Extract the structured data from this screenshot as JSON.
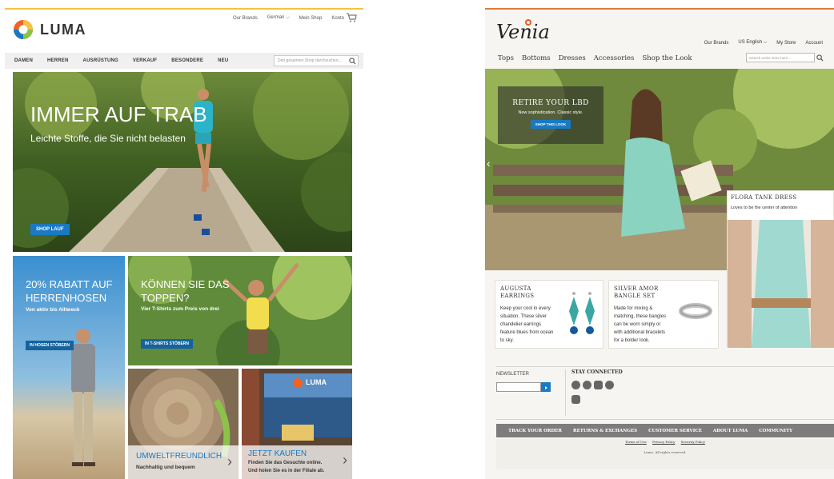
{
  "luma": {
    "brand": "LUMA",
    "toplinks": [
      "Our Brands",
      "German",
      "Mein Shop",
      "Konto"
    ],
    "nav": [
      "DAMEN",
      "HERREN",
      "AUSRÜSTUNG",
      "VERKAUF",
      "BESONDERE",
      "NEU"
    ],
    "search_placeholder": "Den gesamten Shop durchsuchen...",
    "hero": {
      "title": "IMMER AUF TRAB",
      "subtitle": "Leichte Stoffe, die Sie nicht belasten",
      "button": "SHOP LAUF"
    },
    "tile_pants": {
      "title_line1": "20% RABATT AUF",
      "title_line2": "HERRENHOSEN",
      "subtitle": "Von aktiv bis Alltweck",
      "button": "IN HOSEN STÖBERN"
    },
    "tile_top": {
      "title_line1": "KÖNNEN SIE DAS",
      "title_line2": "TOPPEN?",
      "subtitle": "Vier T-Shirts zum Preis von drei",
      "button": "IN T-SHIRTS STÖBERN"
    },
    "tile_eco": {
      "title": "UMWELTFREUNDLICH",
      "subtitle": "Nachhaltig und bequem"
    },
    "tile_buy": {
      "title": "JETZT KAUFEN",
      "subtitle_line1": "Finden Sie das Gesuchte online.",
      "subtitle_line2": "Und holen Sie es in der Filiale ab.",
      "banner_text": "LUMA"
    }
  },
  "venia": {
    "brand": "Venia",
    "toplinks": [
      "Our Brands",
      "US English",
      "My Store",
      "Account"
    ],
    "nav": [
      "Tops",
      "Bottoms",
      "Dresses",
      "Accessories",
      "Shop the Look"
    ],
    "search_placeholder": "Search entire store here...",
    "promo": {
      "title": "RETIRE YOUR LBD",
      "subtitle": "New sophistication. Classic style.",
      "button": "SHOP THIS LOOK"
    },
    "flora": {
      "title": "FLORA TANK DRESS",
      "subtitle": "Loves to be the center of attention"
    },
    "card_earrings": {
      "title_line1": "AUGUSTA",
      "title_line2": "EARRINGS",
      "text": [
        "Keep your cool in every",
        "situation. These silver",
        "chandelier earrings",
        "feature blues from ocean",
        "to sky."
      ]
    },
    "card_bangle": {
      "title_line1": "SILVER AMOR",
      "title_line2": "BANGLE SET",
      "text": [
        "Made for mixing &",
        "matching, these bangles",
        "can be worn simply or",
        "with additional bracelets",
        "for a bolder look."
      ]
    },
    "newsletter_label": "NEWSLETTER",
    "stay_connected": "STAY CONNECTED",
    "footer_links": [
      "TRACK YOUR ORDER",
      "RETURNS & EXCHANGES",
      "CUSTOMER SERVICE",
      "ABOUT LUMA",
      "COMMUNITY"
    ],
    "legal_links": [
      "Terms of Use",
      "Privacy Policy",
      "Security Policy"
    ],
    "copyright": "Luma. All rights reserved."
  },
  "colors": {
    "accent_blue": "#1979c3",
    "luma_orange": "#f26322",
    "venia_orange": "#e55a2a"
  }
}
